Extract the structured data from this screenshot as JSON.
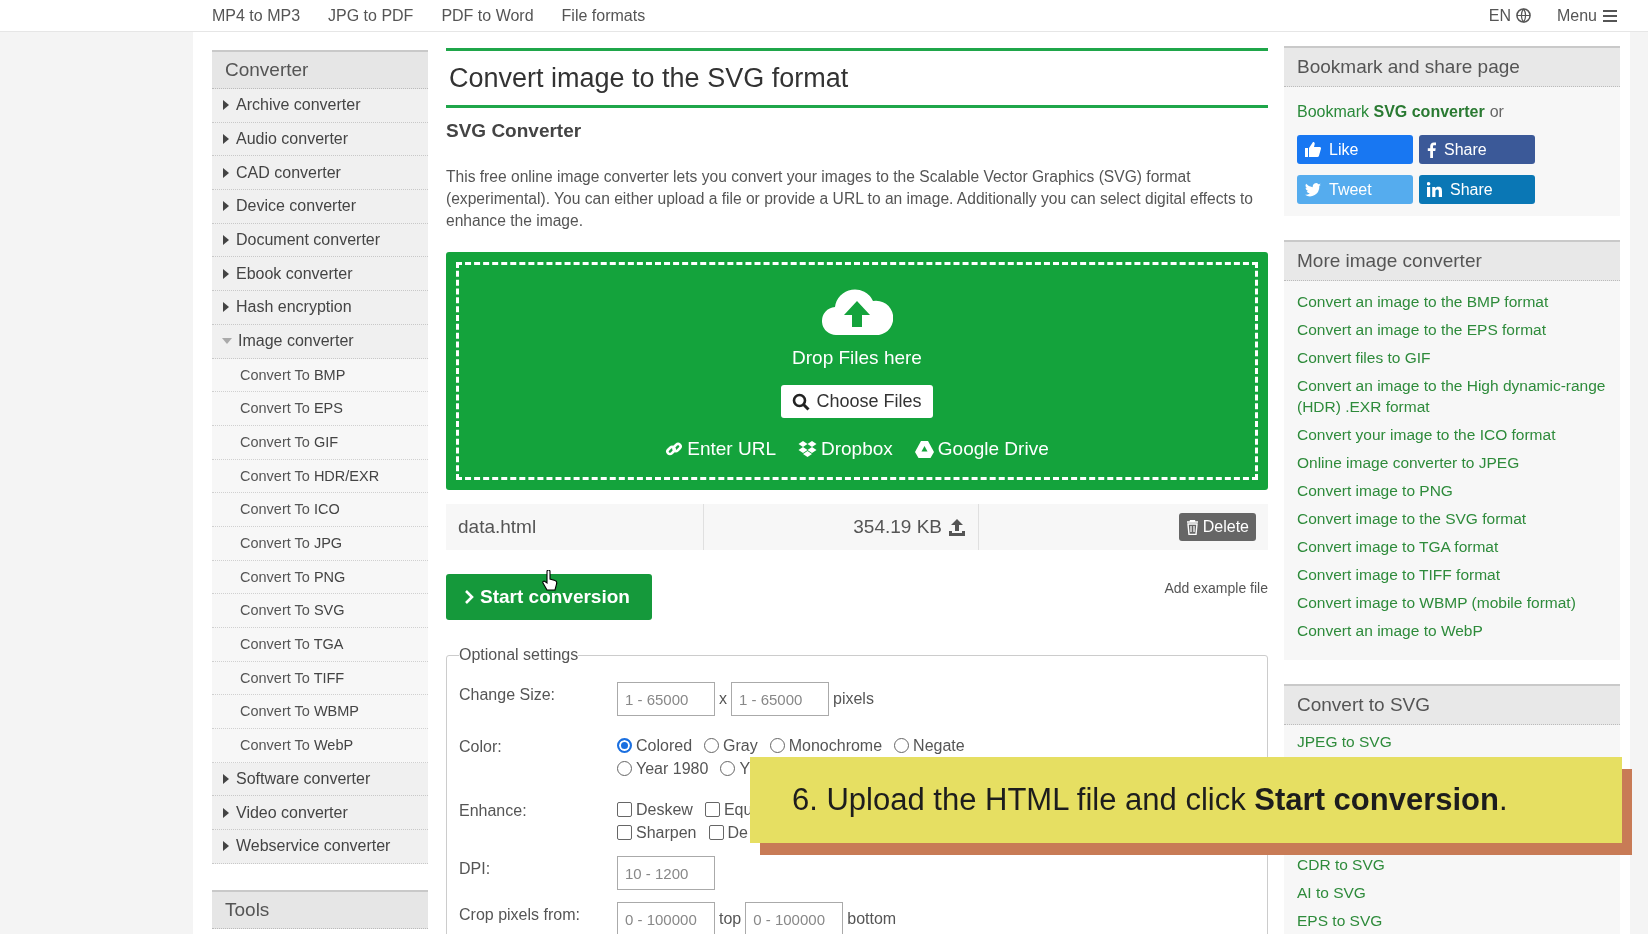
{
  "top_nav": {
    "links": [
      "MP4 to MP3",
      "JPG to PDF",
      "PDF to Word",
      "File formats"
    ],
    "language": "EN",
    "menu": "Menu"
  },
  "sidebar": {
    "title": "Converter",
    "items": [
      {
        "label": "Archive converter",
        "expanded": false
      },
      {
        "label": "Audio converter",
        "expanded": false
      },
      {
        "label": "CAD converter",
        "expanded": false
      },
      {
        "label": "Device converter",
        "expanded": false
      },
      {
        "label": "Document converter",
        "expanded": false
      },
      {
        "label": "Ebook converter",
        "expanded": false
      },
      {
        "label": "Hash encryption",
        "expanded": false
      },
      {
        "label": "Image converter",
        "expanded": true,
        "children": [
          "Convert To **BMP**",
          "Convert To **EPS**",
          "Convert To **GIF**",
          "Convert To **HDR/EXR**",
          "Convert To **ICO**",
          "Convert To **JPG**",
          "Convert To **PNG**",
          "Convert To **SVG**",
          "Convert To **TGA**",
          "Convert To **TIFF**",
          "Convert To **WBMP**",
          "Convert To **WebP**"
        ]
      },
      {
        "label": "Software converter",
        "expanded": false
      },
      {
        "label": "Video converter",
        "expanded": false
      },
      {
        "label": "Webservice converter",
        "expanded": false
      }
    ],
    "tools_title": "Tools"
  },
  "main": {
    "title": "Convert image to the SVG format",
    "subtitle": "SVG Converter",
    "description": "This free online image converter lets you convert your images to the Scalable Vector Graphics (SVG) format (experimental). You can either upload a file or provide a URL to an image. Additionally you can select digital effects to enhance the image.",
    "dropzone": {
      "drop_text": "Drop Files here",
      "choose_button": "Choose Files",
      "sources": [
        {
          "kind": "url",
          "label": "Enter URL"
        },
        {
          "kind": "dropbox",
          "label": "Dropbox"
        },
        {
          "kind": "drive",
          "label": "Google Drive"
        }
      ]
    },
    "file": {
      "name": "data.html",
      "size": "354.19 KB",
      "delete_button": "Delete"
    },
    "start_button": "Start conversion",
    "add_example": "Add example file",
    "settings": {
      "legend": "Optional settings",
      "rows": [
        {
          "label": "Change Size:",
          "lines": [
            [
              {
                "kind": "input",
                "placeholder": "1 - 65000"
              },
              {
                "kind": "text",
                "text": "x"
              },
              {
                "kind": "input",
                "placeholder": "1 - 65000"
              },
              {
                "kind": "text",
                "text": "pixels"
              }
            ]
          ]
        },
        {
          "label": "Color:",
          "lines": [
            [
              {
                "kind": "radio",
                "label": "Colored",
                "selected": true
              },
              {
                "kind": "radio",
                "label": "Gray",
                "selected": false
              },
              {
                "kind": "radio",
                "label": "Monochrome",
                "selected": false
              },
              {
                "kind": "radio",
                "label": "Negate",
                "selected": false
              }
            ],
            [
              {
                "kind": "radio",
                "label": "Year 1980",
                "selected": false
              },
              {
                "kind": "radio",
                "label": "Y",
                "selected": false
              }
            ]
          ]
        },
        {
          "label": "Enhance:",
          "lines": [
            [
              {
                "kind": "checkbox",
                "label": "Deskew",
                "checked": false
              },
              {
                "kind": "checkbox",
                "label": "Equ",
                "checked": false
              }
            ],
            [
              {
                "kind": "checkbox",
                "label": "Sharpen",
                "checked": false
              },
              {
                "kind": "checkbox",
                "label": "De",
                "checked": false
              }
            ]
          ]
        },
        {
          "label": "DPI:",
          "lines": [
            [
              {
                "kind": "input",
                "placeholder": "10 - 1200"
              }
            ]
          ]
        },
        {
          "label": "Crop pixels from:",
          "lines": [
            [
              {
                "kind": "input",
                "placeholder": "0 - 100000"
              },
              {
                "kind": "text",
                "text": "top"
              },
              {
                "kind": "input",
                "placeholder": "0 - 100000"
              },
              {
                "kind": "text",
                "text": "bottom"
              }
            ]
          ]
        }
      ]
    }
  },
  "right": {
    "bookmark": {
      "title": "Bookmark and share page",
      "link": "Bookmark **SVG converter**",
      "suffix": "or",
      "share_buttons": [
        {
          "kind": "like",
          "label": "Like",
          "color": "#1877f2"
        },
        {
          "kind": "facebook",
          "label": "Share",
          "color": "#3b5998"
        },
        {
          "kind": "tweet",
          "label": "Tweet",
          "color": "#55acee"
        },
        {
          "kind": "linkedin",
          "label": "Share",
          "color": "#0a77b5"
        }
      ]
    },
    "more": {
      "title": "More image converter",
      "links": [
        "Convert an image to the BMP format",
        "Convert an image to the EPS format",
        "Convert files to GIF",
        "Convert an image to the High dynamic-range (HDR) .EXR format",
        "Convert your image to the ICO format",
        "Online image converter to JPEG",
        "Convert image to PNG",
        "Convert image to the SVG format",
        "Convert image to TGA format",
        "Convert image to TIFF format",
        "Convert image to WBMP (mobile format)",
        "Convert an image to WebP"
      ]
    },
    "convert_to": {
      "title": "Convert to SVG",
      "links": [
        "JPEG to SVG",
        "CDR to SVG",
        "AI to SVG",
        "EPS to SVG"
      ]
    }
  },
  "caption": {
    "text": "6. Upload the HTML file and click **Start conversion**."
  }
}
